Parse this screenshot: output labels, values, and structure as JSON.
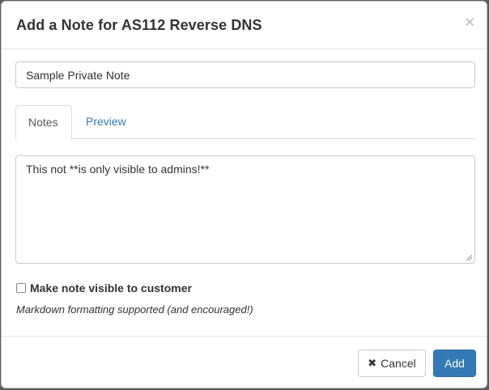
{
  "modal": {
    "title": "Add a Note for AS112 Reverse DNS",
    "close_glyph": "×"
  },
  "form": {
    "title_value": "Sample Private Note",
    "note_value": "This not **is only visible to admins!**",
    "visible_label": "Make note visible to customer",
    "visible_checked": false,
    "help_text": "Markdown formatting supported (and encouraged!)"
  },
  "tabs": [
    {
      "label": "Notes",
      "active": true
    },
    {
      "label": "Preview",
      "active": false
    }
  ],
  "footer": {
    "cancel_icon": "✖",
    "cancel_label": "Cancel",
    "add_label": "Add"
  },
  "colors": {
    "primary": "#337ab7",
    "link": "#337ab7",
    "border": "#cccccc"
  }
}
